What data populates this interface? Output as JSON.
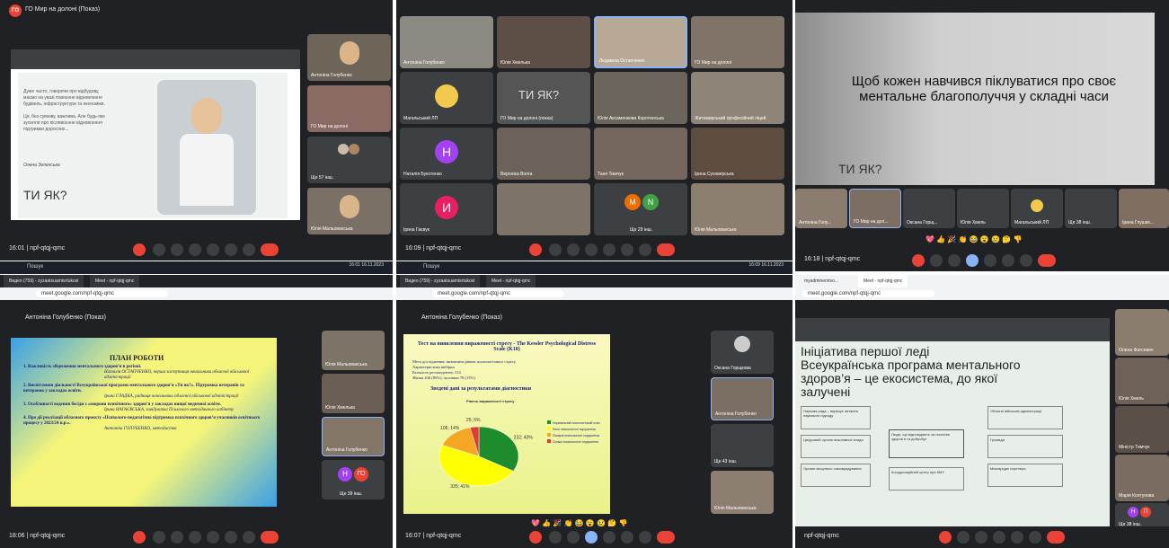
{
  "q1": {
    "title": "ГО Мир на долоні (Показ)",
    "avatar": "ГО",
    "slide_text1": "Дуже часто, говорячи про відбудову, ",
    "slide_text2": "маємо на увазі повоєнне відновлення",
    "slide_text3": "будівель, інфраструктури та економіки.",
    "slide_text4": "Ця, без сумніву, важлива. Але будь-яке",
    "slide_text5": "зусилля про післявоєнне відновлення",
    "slide_text6": "підтримки дорослих...",
    "sign": "Олена Зеленська",
    "logo": "ТИ ЯК?",
    "tiles": [
      "Антоніна Голубенко",
      "ГО Мир на долоні",
      "Ще 57 інш.",
      "Юлія Мальованська"
    ],
    "time": "16:01",
    "code": "npf-qtqj-qmc"
  },
  "q2": {
    "tiles": [
      "Антоніна Голубенко",
      "Юлія Хмелька",
      "Людмила Остапченко",
      "ГО Мир на долоні",
      "Магальський ЛП",
      "ГО Мир на долоні (показ)",
      "Юлія Аксаменкова Коротинська",
      "Житомирський професійний ліцей",
      "Наталія Букотенко",
      "Вероніка Волга",
      "Таня Тимчук",
      "Ірина Суховерська",
      "Ірина Гаєвук",
      "",
      "Ще 29 інш.",
      "Юлія Мальованська"
    ],
    "time": "16:09",
    "code": "npf-qtqj-qmc",
    "logo": "ТИ ЯК?",
    "init_h": "H",
    "init_i": "И",
    "init_m": "M",
    "init_n": "N"
  },
  "q3": {
    "heading": "Щоб кожен навчився  піклуватися про своє ментальне благополуччя у складні часи",
    "logo": "ТИ ЯК?",
    "tiles": [
      "Антоніна Голу...",
      "ГО Мир на дол...",
      "Оксана Горщ...",
      "Юлія Хмель",
      "Магальський ЛП",
      "Ще 38 інш.",
      "Ірина Глуших..."
    ],
    "time": "16:18",
    "code": "npf-qtqj-qmc"
  },
  "taskbar": {
    "search": "Пошук",
    "time1": "16:01",
    "date1": "16.11.2023",
    "lang": "УКР",
    "time2": "16:09",
    "date2": "16.11.2023"
  },
  "q4": {
    "tab1": "Видео (759) - zyzaatsuamtsrtukosl",
    "tab2": "Meet - npf-qtqj-qmc",
    "url": "meet.google.com/npf-qtqj-qmc",
    "presenter": "Антоніна Голубенко (Показ)",
    "plan_title": "ПЛАН РОБОТИ",
    "p1": "1. Важливість збереження ментального здоров’я в регіоні.",
    "p1b": "Наталія ОСТАПЧЕНКО, перша заступниця начальника обласної військової адміністрації",
    "p2": "2. Висвітлення діяльності Всеукраїнської програми ментального здоров’я «Ти як?». Підтримка ветеранів та ветеранок у закладах освіти.",
    "p2b": "Ірина ГЛАДКА, радниця начальника обласної військової адміністрації",
    "p3": "3. Особливості ведення бесіди з «охорони психічного» здоров’я у закладах вищої медичної освіти.",
    "p3b": "Ірина НАГАЄВСЬКА, завідувачка Психолого-методичного кабінету",
    "p4": "4. Про дії реалізації обласного проєкту «Психолого-педагогічна підтримка психічного здоров’я учасників освітнього процесу у 2023/24 н.р.».",
    "p4b": "Антоніна ГОЛУБЕНКО, методистка",
    "tiles": [
      "Юлія Мальованська",
      "Юлія Хмелька",
      "Антоніна Голубенко",
      "Ще 39 інш."
    ],
    "init1": "Н",
    "init2": "ГО",
    "time": "18:06",
    "code": "npf-qtqj-qmc"
  },
  "q5": {
    "presenter": "Антоніна Голубенко (Показ)",
    "ch_title": "Тест на виявлення вираженості стресу - The Kessler Psychological Distress Scale (K10)",
    "body1": "Мета дослідження: визначити рівень психологічного стресу",
    "body2": "Характеристика вибірки",
    "body3": "Кількість респондентів: 514",
    "body4": "Жінки 436 (85%), чоловіки 78 (15%)",
    "summary": "Зведені дані за результатами діагностики",
    "chart_title": "Рівень вираженості стресу",
    "tiles": [
      "Оксана Горщкова",
      "Антоніна Голубенко",
      "Ще 43 інш.",
      "Юлія Мальованська"
    ],
    "time": "16:07",
    "code": "npf-qtqj-qmc"
  },
  "q6": {
    "tab1": "myadminerstvo...",
    "tab2": "Meet - npf-qtqj-qmc",
    "url": "meet.google.com/npf-qtqj-qmc",
    "h1": "Ініціатива першої леді",
    "h2": "Всеукраїнська програма ментального",
    "h3": "здоров’я – це екосистема, до якої",
    "h4": "залучені",
    "boxes": [
      "Наукова рада – вирішує питання наукового підходу",
      "Цифровий органи виконавчої влади",
      "Органи місцевого самоврядування",
      "Люди, що відповідають за психічне здоров’я та добробут",
      "Координаційний центр при КМУ",
      "Обласні військові адміністрації",
      "Громади",
      "Міжнародні партнери"
    ],
    "tiles": [
      "Олена Фатсевич",
      "Юлія Хмель",
      "Міністр Тимчук",
      "Марія Колтунова",
      "Ще 38 інш."
    ],
    "init1": "Н",
    "init2": "П",
    "code": "npf-qtqj-qmc"
  },
  "chart_data": {
    "type": "pie",
    "title": "Рівень вираженості стресу",
    "categories": [
      "Нормальний психологічний стан",
      "Легкі психологічні порушення",
      "Помірні психологічні порушення",
      "Сильні психологічні порушення"
    ],
    "values": [
      232,
      335,
      106,
      25
    ],
    "labels": [
      "232; 40%",
      "335; 41%",
      "106; 14%",
      "25; 5%"
    ],
    "colors": [
      "#1e8c2c",
      "#ffff00",
      "#f5a623",
      "#e53935"
    ]
  },
  "emojis": "💖 👍 🎉 👏 😂 😮 😢 🤔 👎"
}
